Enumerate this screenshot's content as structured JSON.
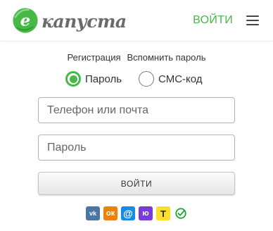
{
  "header": {
    "logo_letter": "e",
    "logo_text": "капуста",
    "login_link": "ВОЙТИ",
    "brand_color": "#47b947",
    "menu_icon": "hamburger-menu-icon"
  },
  "links": {
    "register": "Регистрация",
    "forgot_password": "Вспомнить пароль"
  },
  "login_mode": {
    "selected": "password",
    "options": [
      {
        "id": "password",
        "label": "Пароль"
      },
      {
        "id": "sms",
        "label": "СМС-код"
      }
    ]
  },
  "form": {
    "login_placeholder": "Телефон или почта",
    "login_value": "",
    "password_placeholder": "Пароль",
    "password_value": "",
    "submit_label": "ВОЙТИ"
  },
  "social": [
    {
      "name": "vk-icon",
      "glyph": "vk",
      "color": "#4c75a3"
    },
    {
      "name": "odnoklassniki-icon",
      "glyph": "ок",
      "color": "#ee8208"
    },
    {
      "name": "mail-ru-icon",
      "glyph": "@",
      "color": "#168de2"
    },
    {
      "name": "yoomoney-icon",
      "glyph": "ю",
      "color": "#7a3bd9"
    },
    {
      "name": "tinkoff-icon",
      "glyph": "Т",
      "color": "#ffdd2d"
    },
    {
      "name": "sber-id-icon",
      "glyph": "",
      "color": "#21a038"
    }
  ]
}
